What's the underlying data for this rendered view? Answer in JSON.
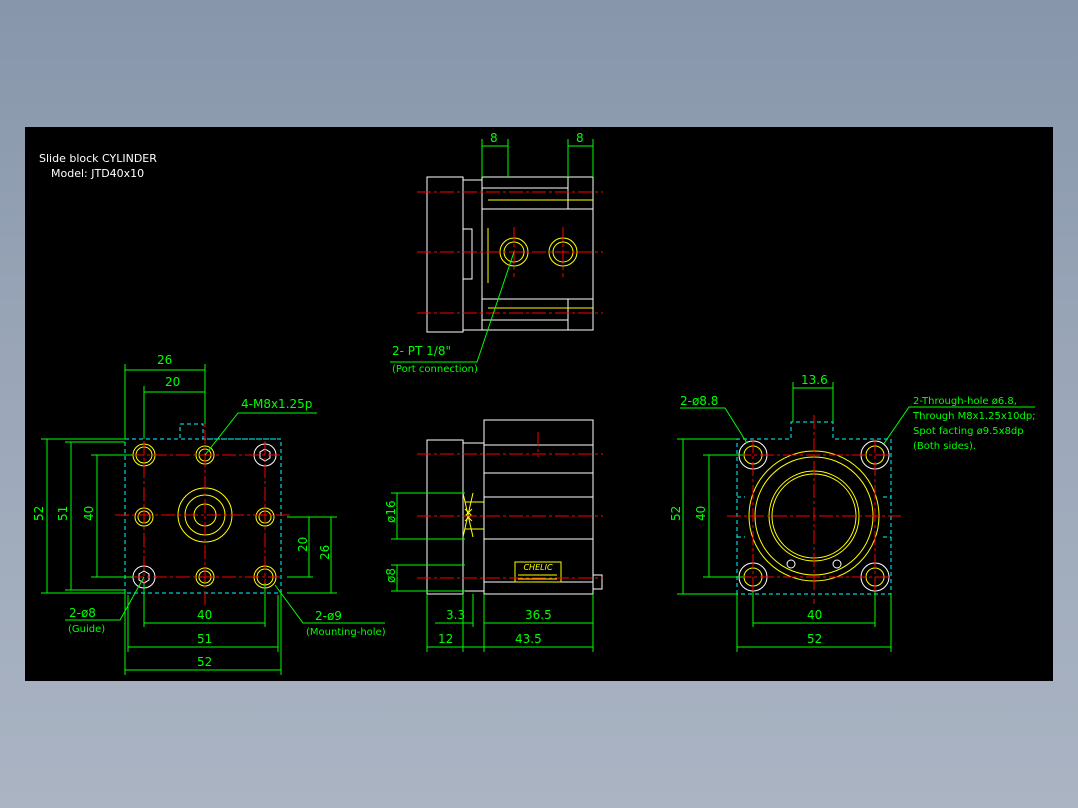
{
  "title": "Slide block CYLINDER",
  "model": "Model:  JTD40x10",
  "colors": {
    "background": "#000000",
    "outline": "#ffffff",
    "hidden": "#ffff00",
    "center": "#ff0000",
    "dimension": "#00ff00",
    "section": "#00ffff"
  },
  "top_view": {
    "dim_left": "8",
    "dim_right": "8",
    "port_label": "2- PT 1/8\"",
    "port_note": "(Port connection)"
  },
  "front_view": {
    "dim_26": "26",
    "dim_20_top": "20",
    "tap_label": "4-M8x1.25p",
    "dim_52_v": "52",
    "dim_51_v": "51",
    "dim_40_v": "40",
    "dim_20_v": "20",
    "dim_26_v": "26",
    "guide_label": "2-ø8",
    "guide_note": "(Guide)",
    "mount_label": "2-ø9",
    "mount_note": "(Mounting-hole)",
    "dim_40_h": "40",
    "dim_51_h": "51",
    "dim_52_h": "52"
  },
  "side_view": {
    "dim_phi16": "ø16",
    "dim_phi8": "ø8",
    "dim_3_3": "3.3",
    "dim_36_5": "36.5",
    "dim_12": "12",
    "dim_43_5": "43.5",
    "brand": "CHELIC"
  },
  "rear_view": {
    "dim_13_6": "13.6",
    "hole_label": "2-ø8.8",
    "through_1": "2-Through-hole ø6.8,",
    "through_2": "Through M8x1.25x10dp;",
    "through_3": "Spot facting ø9.5x8dp",
    "through_4": "(Both sides).",
    "dim_52_v": "52",
    "dim_40_v": "40",
    "dim_40_h": "40",
    "dim_52_h": "52"
  }
}
